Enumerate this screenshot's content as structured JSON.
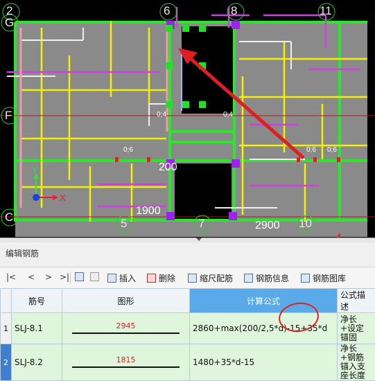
{
  "canvas": {
    "axes": [
      "2",
      "6",
      "8",
      "11",
      "G",
      "F",
      "C",
      "5",
      "7",
      "10"
    ],
    "dims": [
      "200",
      "1900",
      "2900",
      "0;6",
      "0;6",
      "0;6",
      "0;4",
      "0;4"
    ],
    "coord_x": "X",
    "coord_y": "Y"
  },
  "panel": {
    "title": "编辑钢筋",
    "nav": [
      "|<",
      "<",
      ">",
      ">|"
    ],
    "toolbar": {
      "insert": "插入",
      "delete": "删除",
      "scale_rebar": "缩尺配筋",
      "rebar_info": "钢筋信息",
      "rebar_library": "钢筋图库"
    },
    "columns": [
      "筋号",
      "图形",
      "计算公式",
      "公式描述"
    ],
    "rows": [
      {
        "num": "1",
        "id": "SLJ-8.1",
        "shape_value": "2945",
        "formula": "2860+max(200/2,5*d)-15+35*d",
        "desc": "净长+设定锚固"
      },
      {
        "num": "2",
        "id": "SLJ-8.2",
        "shape_value": "1815",
        "formula": "1480+35*d-15",
        "desc": "净长+钢筋锚入支座长度"
      }
    ]
  },
  "colors": {
    "canvas_bg": "#000000",
    "header_active": "#5aa9e8",
    "row_bg": "#dff6dc",
    "annotation": "#e02020"
  }
}
